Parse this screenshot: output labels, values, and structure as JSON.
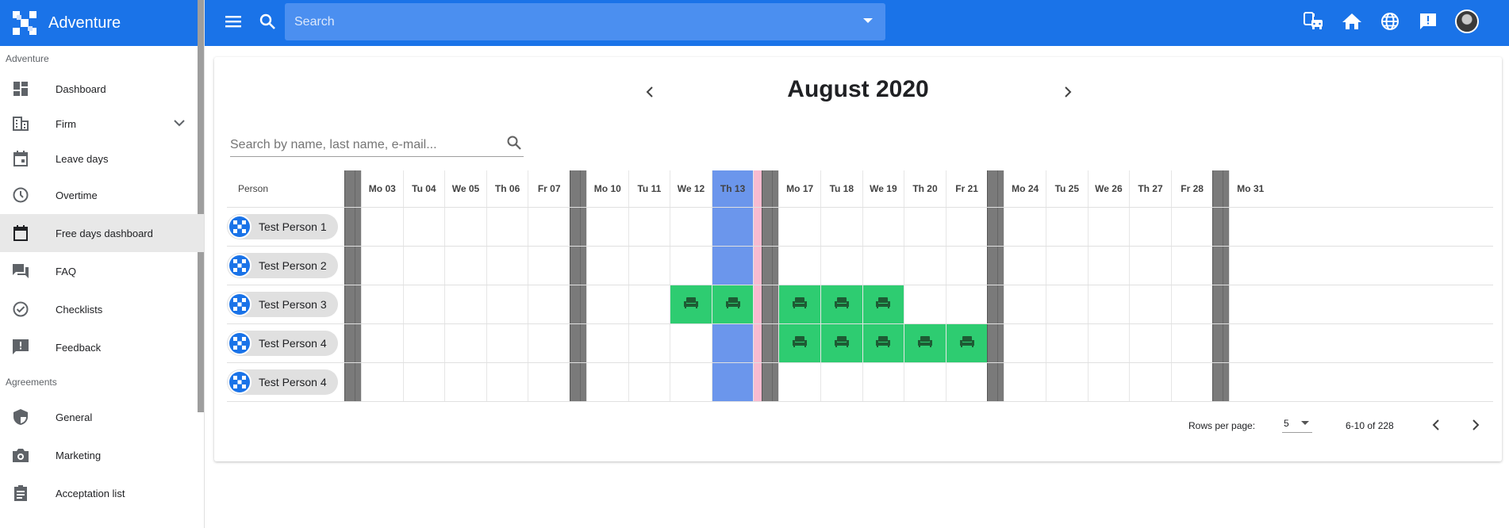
{
  "app": {
    "title": "Adventure"
  },
  "topbar": {
    "search_placeholder": "Search"
  },
  "sidebar": {
    "section1": "Adventure",
    "items": [
      {
        "label": "Dashboard",
        "icon": "dashboard-icon"
      },
      {
        "label": "Firm",
        "icon": "building-icon"
      },
      {
        "label": "Leave days",
        "icon": "event-icon"
      },
      {
        "label": "Overtime",
        "icon": "clock-icon"
      },
      {
        "label": "Free days dashboard",
        "icon": "calendar-icon"
      },
      {
        "label": "FAQ",
        "icon": "forum-icon"
      },
      {
        "label": "Checklists",
        "icon": "check-circle-icon"
      },
      {
        "label": "Feedback",
        "icon": "feedback-icon"
      }
    ],
    "section2": "Agreements",
    "items2": [
      {
        "label": "General",
        "icon": "shield-icon"
      },
      {
        "label": "Marketing",
        "icon": "camera-icon"
      },
      {
        "label": "Acceptation list",
        "icon": "clipboard-icon"
      }
    ]
  },
  "calendar": {
    "month_title": "August 2020",
    "search_placeholder": "Search by name, last name, e-mail...",
    "person_header": "Person",
    "days": [
      "Mo 03",
      "Tu 04",
      "We 05",
      "Th 06",
      "Fr 07",
      "Mo 10",
      "Tu 11",
      "We 12",
      "Th 13",
      "Mo 17",
      "Tu 18",
      "We 19",
      "Th 20",
      "Fr 21",
      "Mo 24",
      "Tu 25",
      "We 26",
      "Th 27",
      "Fr 28",
      "Mo 31"
    ],
    "persons": [
      "Test Person 1",
      "Test Person 2",
      "Test Person 3",
      "Test Person 4",
      "Test Person 4"
    ],
    "leave": {
      "Test Person 3": [
        "We 12",
        "Th 13",
        "Mo 17",
        "Tu 18",
        "We 19"
      ],
      "Test Person 4": [
        "Mo 17",
        "Tu 18",
        "We 19",
        "Th 20",
        "Fr 21"
      ]
    },
    "today": "Th 13"
  },
  "pagination": {
    "rows_label": "Rows per page:",
    "rows_value": "5",
    "range": "6-10 of 228"
  },
  "colors": {
    "primary": "#1a73e8",
    "leave": "#2ecc71",
    "today": "#6b96ec",
    "weekend": "#7a7a7a",
    "holiday": "#f8bbd0"
  }
}
